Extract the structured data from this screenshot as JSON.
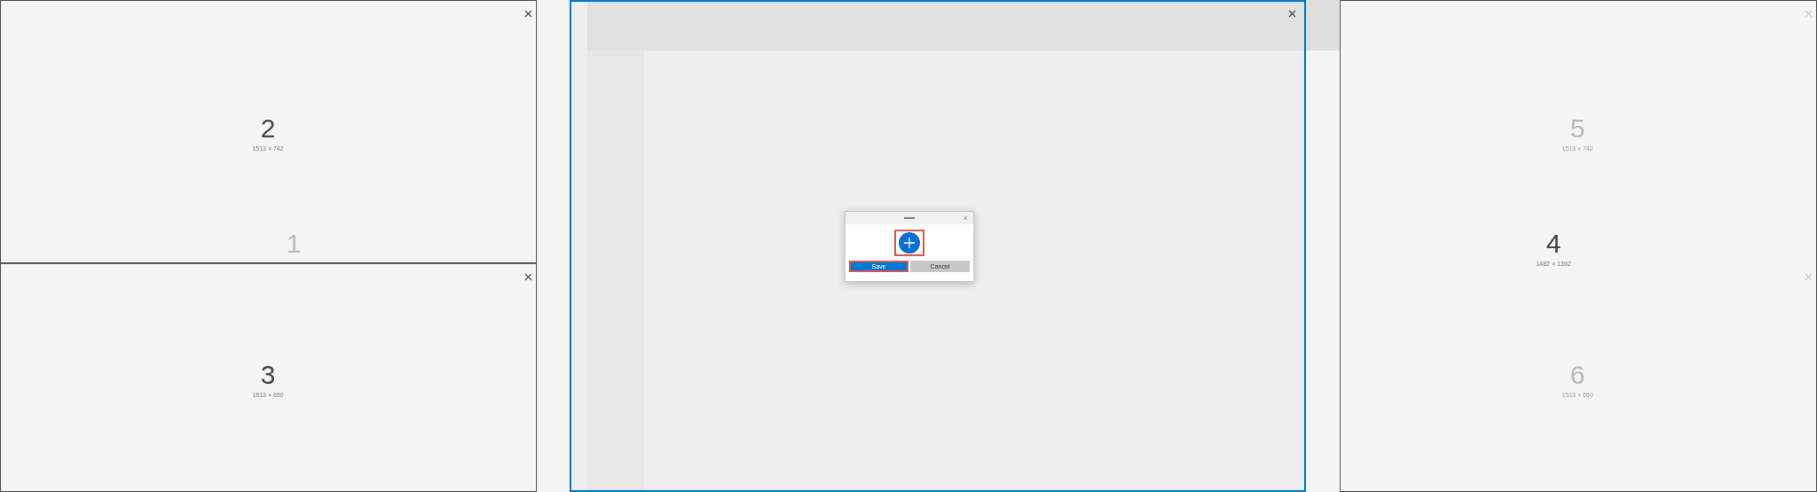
{
  "zones": [
    {
      "number": "1",
      "selected": false,
      "closable": false
    },
    {
      "number": "2",
      "size": "1513 × 742",
      "selected": false,
      "closable": true
    },
    {
      "number": "3",
      "size": "1513 × 650",
      "selected": false,
      "closable": true
    },
    {
      "number": "4",
      "size": "1482 × 1392",
      "selected": false,
      "closable": false
    },
    {
      "number": "5",
      "size": "1513 × 742",
      "selected": false,
      "closable": true
    },
    {
      "number": "6",
      "size": "1513 × 650",
      "selected": false,
      "closable": true
    },
    {
      "selected": true,
      "closable": true
    }
  ],
  "dialog": {
    "close": "×",
    "buttons": [
      {
        "label": "Save",
        "kind": "primary",
        "highlighted": true
      },
      {
        "label": "Cancel",
        "kind": "secondary",
        "highlighted": false
      }
    ],
    "add_highlighted": true
  }
}
